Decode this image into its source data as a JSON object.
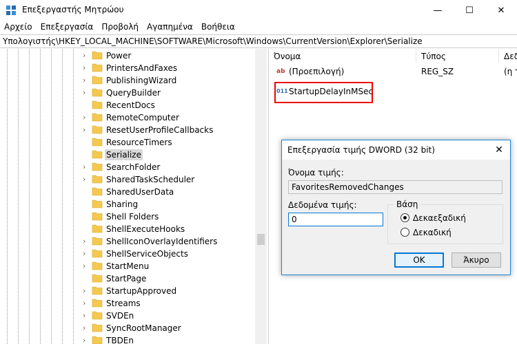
{
  "window": {
    "title": "Επεξεργαστής Μητρώου",
    "minimize_glyph": "—",
    "maximize_glyph": "☐",
    "close_glyph": "✕"
  },
  "menu": [
    "Αρχείο",
    "Επεξεργασία",
    "Προβολή",
    "Αγαπημένα",
    "Βοήθεια"
  ],
  "address": "Υπολογιστής\\HKEY_LOCAL_MACHINE\\SOFTWARE\\Microsoft\\Windows\\CurrentVersion\\Explorer\\Serialize",
  "tree": {
    "items": [
      {
        "label": "Power",
        "expandable": true
      },
      {
        "label": "PrintersAndFaxes",
        "expandable": true
      },
      {
        "label": "PublishingWizard",
        "expandable": true
      },
      {
        "label": "QueryBuilder",
        "expandable": true
      },
      {
        "label": "RecentDocs",
        "expandable": false
      },
      {
        "label": "RemoteComputer",
        "expandable": true
      },
      {
        "label": "ResetUserProfileCallbacks",
        "expandable": true
      },
      {
        "label": "ResourceTimers",
        "expandable": false
      },
      {
        "label": "Serialize",
        "expandable": false,
        "selected": true
      },
      {
        "label": "SearchFolder",
        "expandable": true
      },
      {
        "label": "SharedTaskScheduler",
        "expandable": true
      },
      {
        "label": "SharedUserData",
        "expandable": false
      },
      {
        "label": "Sharing",
        "expandable": false
      },
      {
        "label": "Shell Folders",
        "expandable": false
      },
      {
        "label": "ShellExecuteHooks",
        "expandable": false
      },
      {
        "label": "ShellIconOverlayIdentifiers",
        "expandable": true
      },
      {
        "label": "ShellServiceObjects",
        "expandable": true
      },
      {
        "label": "StartMenu",
        "expandable": true
      },
      {
        "label": "StartPage",
        "expandable": false
      },
      {
        "label": "StartupApproved",
        "expandable": true
      },
      {
        "label": "Streams",
        "expandable": true
      },
      {
        "label": "SVDEn",
        "expandable": true
      },
      {
        "label": "SyncRootManager",
        "expandable": true
      },
      {
        "label": "TBDEn",
        "expandable": true
      }
    ],
    "chevron_glyph": "›",
    "folder_color": "#f3c94f"
  },
  "list": {
    "columns": {
      "name": "Όνομα",
      "type": "Τύπος",
      "data": "Δεδ"
    },
    "rows": [
      {
        "icon": "ab",
        "name": "(Προεπιλογή)",
        "type": "REG_SZ",
        "data": "(η τ"
      },
      {
        "icon": "011",
        "name": "StartupDelayInMSec",
        "type": "",
        "data": ""
      }
    ]
  },
  "dialog": {
    "title": "Επεξεργασία τιμής DWORD (32 bit)",
    "close_glyph": "✕",
    "value_name_label": "Όνομα τιμής:",
    "value_name": "FavoritesRemovedChanges",
    "value_data_label": "Δεδομένα τιμής:",
    "value_data": "0",
    "base_label": "Βάση",
    "radio_hex": "Δεκαεξαδική",
    "radio_dec": "Δεκαδική",
    "selected_base": "hex",
    "ok_label": "OK",
    "cancel_label": "Άκυρο"
  },
  "colors": {
    "highlight_box": "#e00000",
    "accent": "#0078d7"
  }
}
